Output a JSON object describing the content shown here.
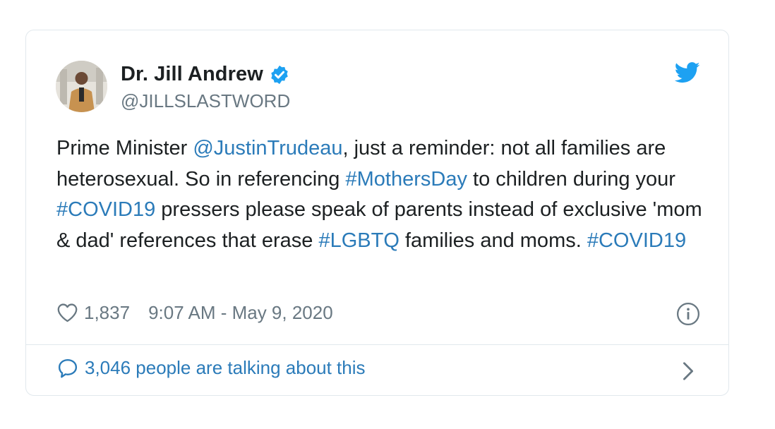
{
  "tweet": {
    "author": {
      "display_name": "Dr. Jill Andrew",
      "handle": "@JILLSLASTWORD",
      "verified": true
    },
    "body": [
      {
        "text": "Prime Minister "
      },
      {
        "text": "@JustinTrudeau",
        "link": true
      },
      {
        "text": ", just a reminder: not all families are heterosexual. So in referencing "
      },
      {
        "text": "#MothersDay",
        "link": true
      },
      {
        "text": " to children during your "
      },
      {
        "text": "#COVID19",
        "link": true
      },
      {
        "text": " pressers please speak of parents instead of exclusive 'mom & dad' references that erase "
      },
      {
        "text": "#LGBTQ",
        "link": true
      },
      {
        "text": " families and moms. "
      },
      {
        "text": "#COVID19",
        "link": true
      }
    ],
    "like_count": "1,837",
    "timestamp": "9:07 AM - May 9, 2020",
    "conversation_label": "3,046 people are talking about this"
  },
  "icons": {
    "verified": "verified-badge-icon",
    "brand": "twitter-bird-icon",
    "like": "heart-icon",
    "info": "info-icon",
    "conversation": "speech-bubble-icon",
    "chevron": "chevron-right-icon"
  },
  "colors": {
    "link": "#2b7bb9",
    "brand": "#1da1f2",
    "muted": "#697882",
    "text": "#1c2022",
    "border": "#e1e8ed"
  }
}
